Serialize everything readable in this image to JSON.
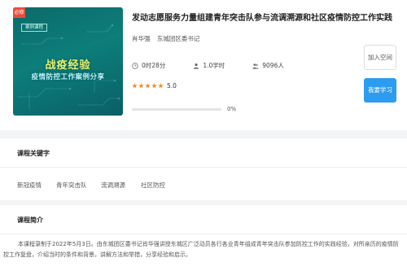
{
  "thumbnail": {
    "corner_label": "必修",
    "badge": "案例课程",
    "title_line1": "战疫经验",
    "title_line2": "疫情防控工作案例分享"
  },
  "course": {
    "title": "发动志愿服务力量组建青年突击队参与流调溯源和社区疫情防控工作实践",
    "teacher": "肖华强",
    "org": "东城团区委书记",
    "duration": "0时28分",
    "credits": "1.0学时",
    "learners": "9096人",
    "rating_value": 5,
    "rating": "5.0",
    "progress_value": 0,
    "progress": "0%"
  },
  "actions": {
    "favorite": "加入空间",
    "study": "我要学习"
  },
  "keywords_section": {
    "title": "课程关键字",
    "items": [
      "新冠疫情",
      "青年突击队",
      "流调溯源",
      "社区防控"
    ]
  },
  "intro_section": {
    "title": "课程简介",
    "text": "本课程录制于2022年5月3日。由东城团区委书记肖华强讲授东城区广泛动员各行各业青年组成青年突击队参加防控工作的实践经验，对所亲历的疫情防控工作复盘，介绍当时的条件和背景，讲解方法和举措，分享经验和启示。"
  },
  "colors": {
    "accent": "#2d9cf0",
    "star": "#f28a1a",
    "thumb_bg": "#0d7e7a"
  },
  "icons": [
    "clock-icon",
    "user-icon",
    "people-icon",
    "star-icon"
  ]
}
